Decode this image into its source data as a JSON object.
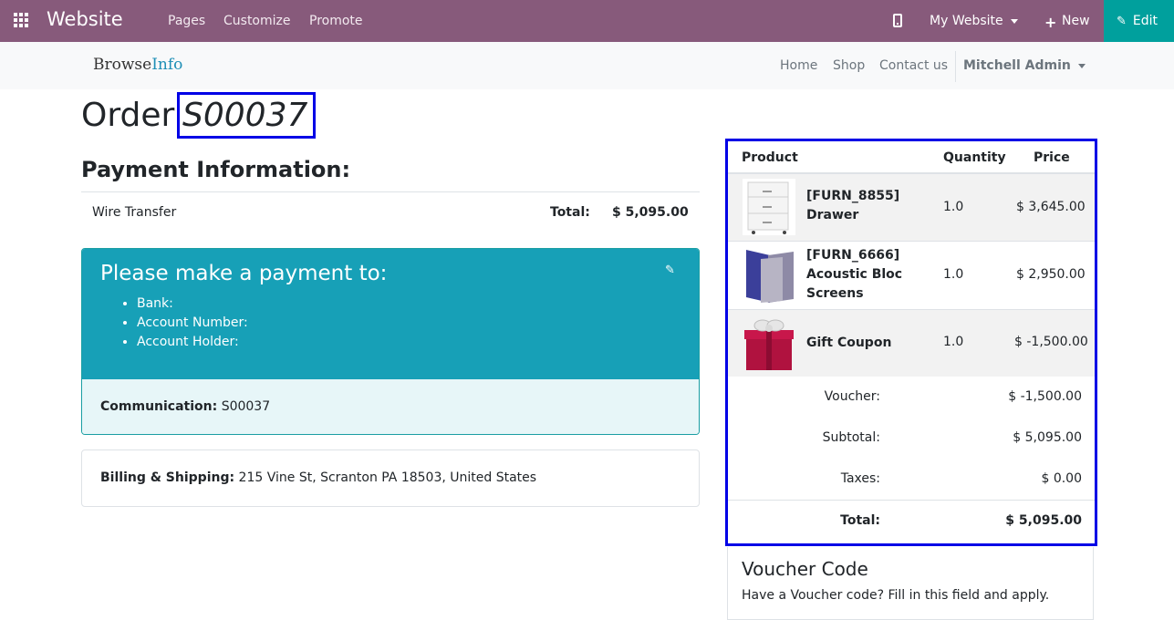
{
  "topbar": {
    "brand": "Website",
    "menu": [
      "Pages",
      "Customize",
      "Promote"
    ],
    "website_select": "My Website",
    "new_label": "New",
    "edit_label": "Edit",
    "bg_color": "#875a7b",
    "edit_color": "#00a09d"
  },
  "siteheader": {
    "logo_left": "Browse",
    "logo_right": "Info",
    "nav": [
      "Home",
      "Shop",
      "Contact us"
    ],
    "user": "Mitchell Admin"
  },
  "order": {
    "label": "Order",
    "number": "S00037"
  },
  "payment": {
    "heading": "Payment Information:",
    "acquirer": "Wire Transfer",
    "total_label": "Total:",
    "total_value": "$ 5,095.00",
    "instructions_title": "Please make a payment to:",
    "fields": [
      "Bank:",
      "Account Number:",
      "Account Holder:"
    ],
    "communication_label": "Communication:",
    "communication_value": "S00037"
  },
  "billing": {
    "label": "Billing & Shipping:",
    "address": "215 Vine St, Scranton PA 18503, United States"
  },
  "cart": {
    "headers": {
      "product": "Product",
      "quantity": "Quantity",
      "price": "Price"
    },
    "lines": [
      {
        "name_l1": "[FURN_8855]",
        "name_l2": "Drawer",
        "name_l3": "",
        "qty": "1.0",
        "price": "$ 3,645.00",
        "icon": "drawer-image"
      },
      {
        "name_l1": "[FURN_6666]",
        "name_l2": "Acoustic Bloc",
        "name_l3": "Screens",
        "qty": "1.0",
        "price": "$ 2,950.00",
        "icon": "screens-image"
      },
      {
        "name_l1": "Gift Coupon",
        "name_l2": "",
        "name_l3": "",
        "qty": "1.0",
        "price": "$ -1,500.00",
        "icon": "gift-image"
      }
    ],
    "summary": {
      "voucher_label": "Voucher:",
      "voucher_value": "$ -1,500.00",
      "subtotal_label": "Subtotal:",
      "subtotal_value": "$ 5,095.00",
      "taxes_label": "Taxes:",
      "taxes_value": "$ 0.00",
      "total_label": "Total:",
      "total_value": "$ 5,095.00"
    }
  },
  "voucher": {
    "title": "Voucher Code",
    "description": "Have a Voucher code? Fill in this field and apply."
  }
}
